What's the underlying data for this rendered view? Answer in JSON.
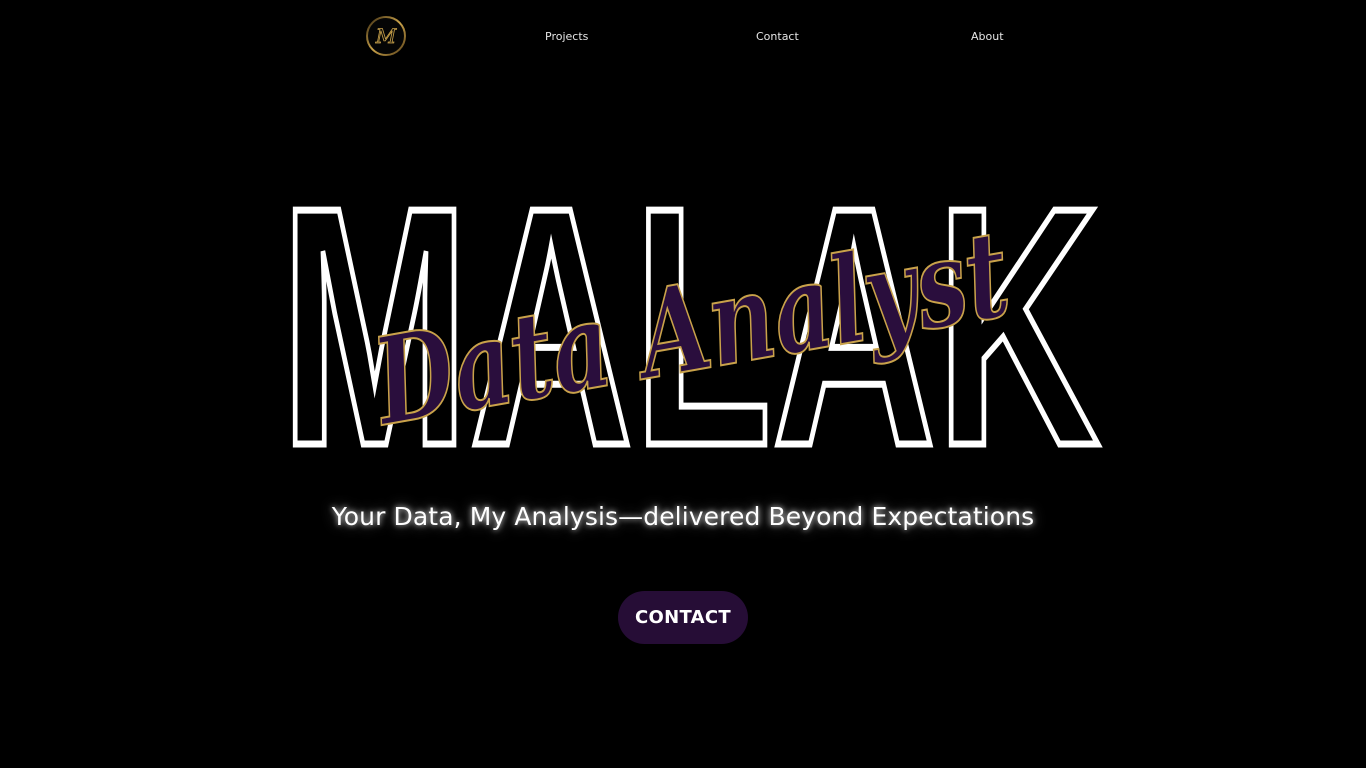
{
  "header": {
    "logo_letter": "M",
    "nav": {
      "projects": "Projects",
      "contact": "Contact",
      "about": "About"
    }
  },
  "hero": {
    "name": "MALAK",
    "role": "Data Analyst",
    "tagline": "Your Data, My Analysis—delivered Beyond Expectations",
    "cta_label": "CONTACT"
  },
  "colors": {
    "background": "#000000",
    "accent_purple": "#260d36",
    "gold": "#c9a24a",
    "outline_white": "#ffffff"
  },
  "icons": {
    "logo": "m-monogram-icon"
  }
}
